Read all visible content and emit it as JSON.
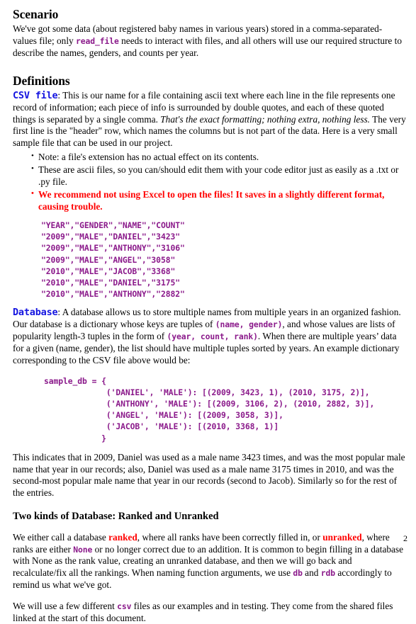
{
  "document": {
    "page_number": "2"
  },
  "scenario": {
    "heading": "Scenario",
    "para_1a": "We've got some data (about registered baby names in various years) stored in a comma-separated-values file; only ",
    "code_read_file": "read_file",
    "para_1b": " needs to interact with files, and all others will use our required structure to describe the names, genders, and counts per year."
  },
  "definitions": {
    "heading": "Definitions",
    "csv": {
      "term": "CSV file",
      "text_a": ": This is our name for a file containing ascii text where each line in the file represents one record of information; each piece of info is surrounded by double quotes, and each of these quoted things is separated by a single comma. ",
      "italic": "That's the exact formatting; nothing extra, nothing less.",
      "text_b": " The very first line is the \"header\" row, which names the columns but is not part of the data. Here is a very small sample file that can be used in our project."
    },
    "notes": [
      {
        "text": "Note: a file's extension has no actual effect on its contents.",
        "style": "normal"
      },
      {
        "text": "These are ascii files, so you can/should edit them with your code editor just as easily as a .txt or .py file.",
        "style": "normal"
      },
      {
        "text": "We recommend not using Excel to open the files! It saves in a slightly different format, causing trouble.",
        "style": "warning"
      }
    ],
    "csv_sample": "\"YEAR\",\"GENDER\",\"NAME\",\"COUNT\"\n\"2009\",\"MALE\",\"DANIEL\",\"3423\"\n\"2009\",\"MALE\",\"ANTHONY\",\"3106\"\n\"2009\",\"MALE\",\"ANGEL\",\"3058\"\n\"2010\",\"MALE\",\"JACOB\",\"3368\"\n\"2010\",\"MALE\",\"DANIEL\",\"3175\"\n\"2010\",\"MALE\",\"ANTHONY\",\"2882\"",
    "database": {
      "term": "Database",
      "text_a": ": A database allows us to store multiple names from multiple years in an organized fashion. Our database is a dictionary whose keys are tuples of ",
      "code_key": "(name, gender)",
      "text_b": ", and whose values are lists of popularity length-3 tuples in the form of ",
      "code_value": "(year, count, rank)",
      "text_c": ". When there are multiple years’ data for a given (name, gender), the list should have multiple tuples sorted by years. An example dictionary corresponding to the CSV file above would be:"
    },
    "db_sample": "sample_db = {\n             ('DANIEL', 'MALE'): [(2009, 3423, 1), (2010, 3175, 2)],\n             ('ANTHONY', 'MALE'): [(2009, 3106, 2), (2010, 2882, 3)],\n             ('ANGEL', 'MALE'): [(2009, 3058, 3)],\n             ('JACOB', 'MALE'): [(2010, 3368, 1)]\n            }",
    "explanation": "This indicates that in 2009, Daniel was used as a male name 3423 times, and was the most popular male name that year in our records; also, Daniel was used as a male name 3175 times in 2010, and was the second-most popular male name that year in our records (second to Jacob). Similarly so for the rest of the entries."
  },
  "two_kinds": {
    "heading": "Two kinds of Database: Ranked and Unranked",
    "para1_a": "We either call a database ",
    "ranked": "ranked",
    "para1_b": ", where all ranks have been correctly filled in, or ",
    "unranked": "unranked",
    "para1_c": ", where ranks are either ",
    "code_none": "None",
    "para1_d": " or no longer correct due to an addition. It is common to begin filling in a database with None as the rank value, creating an unranked database, and then we will go back and recalculate/fix all the rankings. When naming function arguments, we use ",
    "code_db": "db",
    "para1_e": " and ",
    "code_rdb": "rdb",
    "para1_f": " accordingly to remind us what we've got.",
    "para2_a": "We will use a few different ",
    "code_csv": "csv",
    "para2_b": " files as our examples and in testing. They come from the shared files linked at the start of this document."
  },
  "colors": {
    "term_blue": "#1414e0",
    "code_purple": "#8b1a8b",
    "warning_red": "#ff0000",
    "text_black": "#000000",
    "background": "#ffffff"
  }
}
